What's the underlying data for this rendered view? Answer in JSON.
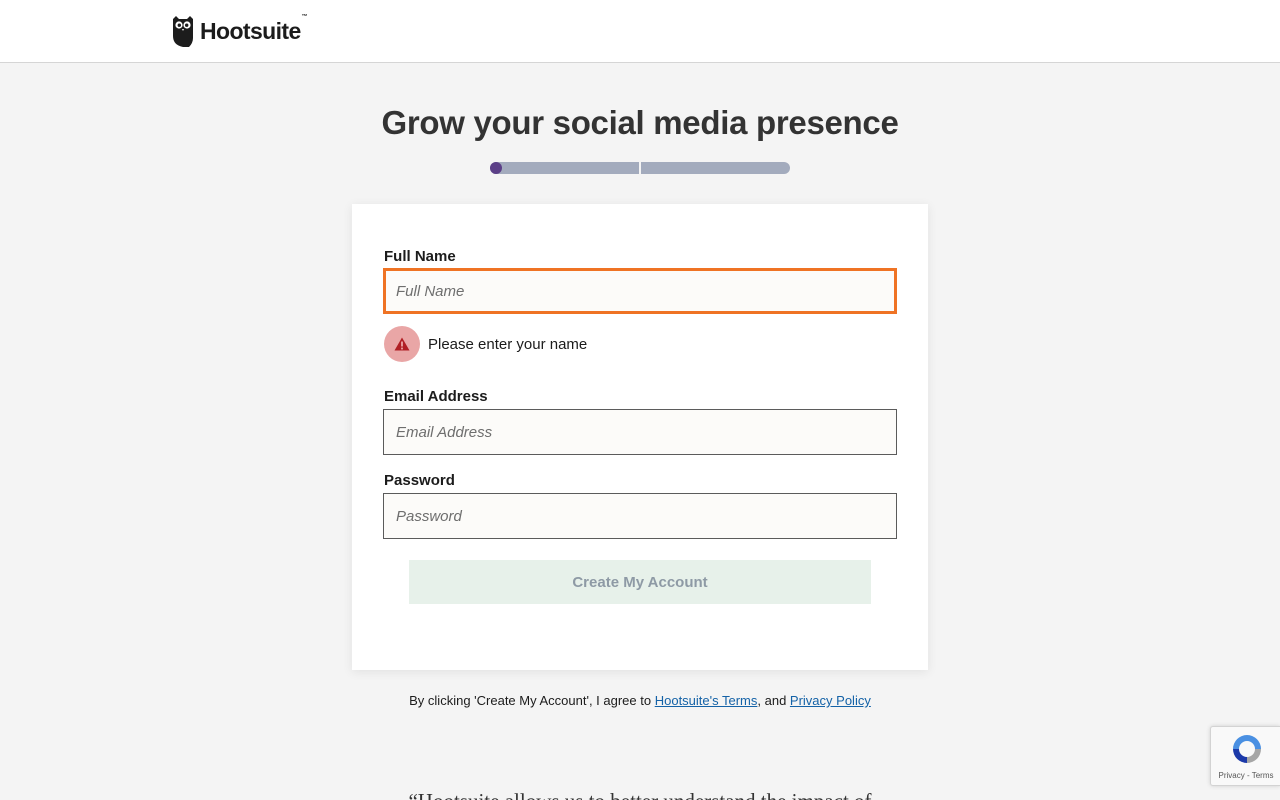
{
  "header": {
    "logo_text": "Hootsuite",
    "logo_tm": "™"
  },
  "headline": "Grow your social media presence",
  "progress": {
    "current_step": 1,
    "total_steps": 2,
    "fill_fraction": 0.0
  },
  "form": {
    "full_name": {
      "label": "Full Name",
      "placeholder": "Full Name",
      "value": "",
      "error": "Please enter your name"
    },
    "email": {
      "label": "Email Address",
      "placeholder": "Email Address",
      "value": ""
    },
    "password": {
      "label": "Password",
      "placeholder": "Password",
      "value": ""
    },
    "submit_label": "Create My Account"
  },
  "legal": {
    "prefix": "By clicking 'Create My Account', I agree to ",
    "terms_link": "Hootsuite's Terms",
    "middle": ", and ",
    "privacy_link": "Privacy Policy"
  },
  "quote_text": "“Hootsuite allows us to better understand the impact of",
  "recaptcha": {
    "links": "Privacy - Terms"
  },
  "colors": {
    "accent_purple": "#5b3f87",
    "error_border": "#ef7324",
    "link": "#1462a7",
    "submit_disabled_bg": "#e7f1ea"
  }
}
